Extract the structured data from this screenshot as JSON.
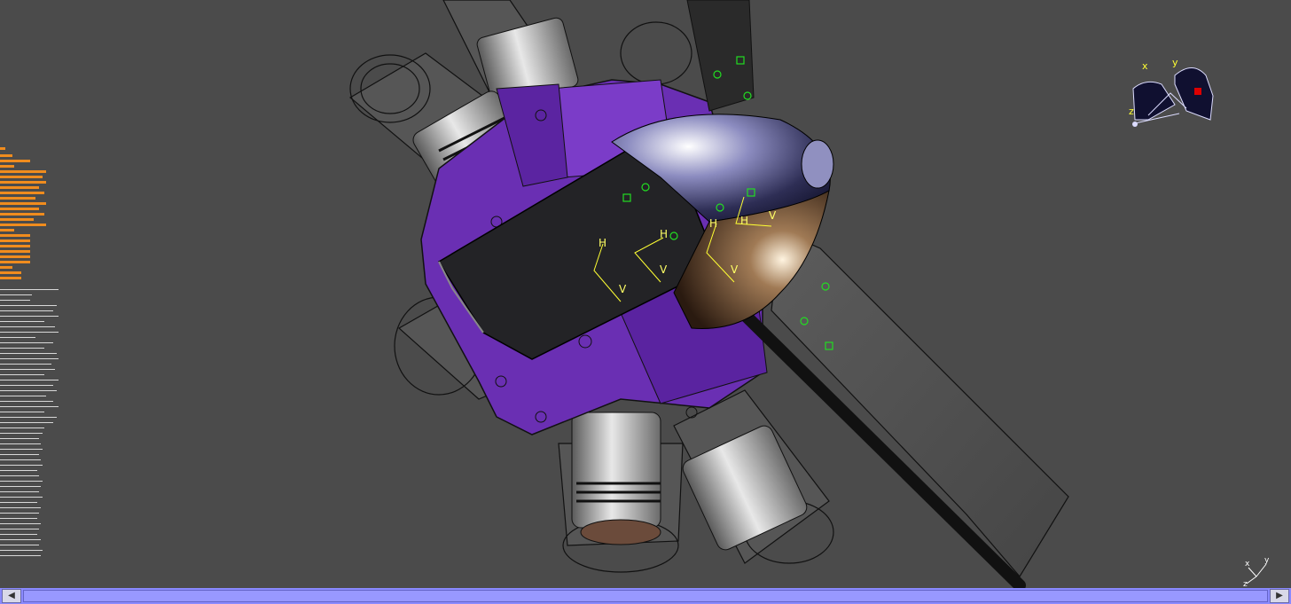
{
  "viewer": {
    "background": "#4b4b4b",
    "body_color": "#6a2fb3",
    "geometry_color": "#2a2a2a"
  },
  "annotations": [
    {
      "text": "H"
    },
    {
      "text": "V"
    },
    {
      "text": "H"
    },
    {
      "text": "V"
    },
    {
      "text": "H"
    },
    {
      "text": "V"
    },
    {
      "text": "H"
    },
    {
      "text": "V"
    }
  ],
  "compass": {
    "x": "x",
    "y": "y",
    "z": "z",
    "icon": "compass-icon"
  },
  "axis_triad": {
    "x": "x",
    "y": "y",
    "z": "z",
    "icon": "axis-triad-icon"
  },
  "scrollbar": {
    "left": "◀",
    "right": "▶",
    "color": "#8a8aff"
  }
}
